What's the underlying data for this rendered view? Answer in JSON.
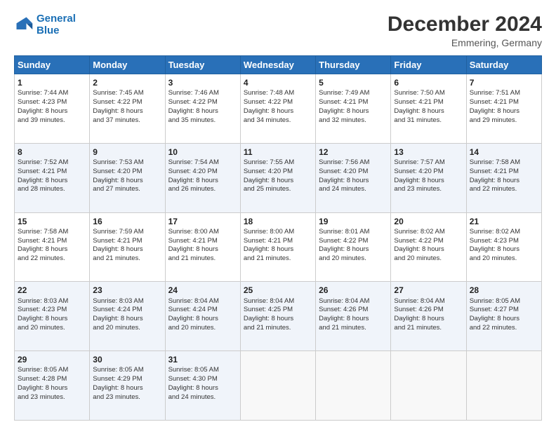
{
  "header": {
    "logo_line1": "General",
    "logo_line2": "Blue",
    "month_year": "December 2024",
    "location": "Emmering, Germany"
  },
  "days_of_week": [
    "Sunday",
    "Monday",
    "Tuesday",
    "Wednesday",
    "Thursday",
    "Friday",
    "Saturday"
  ],
  "weeks": [
    [
      {
        "day": 1,
        "lines": [
          "Sunrise: 7:44 AM",
          "Sunset: 4:23 PM",
          "Daylight: 8 hours",
          "and 39 minutes."
        ]
      },
      {
        "day": 2,
        "lines": [
          "Sunrise: 7:45 AM",
          "Sunset: 4:22 PM",
          "Daylight: 8 hours",
          "and 37 minutes."
        ]
      },
      {
        "day": 3,
        "lines": [
          "Sunrise: 7:46 AM",
          "Sunset: 4:22 PM",
          "Daylight: 8 hours",
          "and 35 minutes."
        ]
      },
      {
        "day": 4,
        "lines": [
          "Sunrise: 7:48 AM",
          "Sunset: 4:22 PM",
          "Daylight: 8 hours",
          "and 34 minutes."
        ]
      },
      {
        "day": 5,
        "lines": [
          "Sunrise: 7:49 AM",
          "Sunset: 4:21 PM",
          "Daylight: 8 hours",
          "and 32 minutes."
        ]
      },
      {
        "day": 6,
        "lines": [
          "Sunrise: 7:50 AM",
          "Sunset: 4:21 PM",
          "Daylight: 8 hours",
          "and 31 minutes."
        ]
      },
      {
        "day": 7,
        "lines": [
          "Sunrise: 7:51 AM",
          "Sunset: 4:21 PM",
          "Daylight: 8 hours",
          "and 29 minutes."
        ]
      }
    ],
    [
      {
        "day": 8,
        "lines": [
          "Sunrise: 7:52 AM",
          "Sunset: 4:21 PM",
          "Daylight: 8 hours",
          "and 28 minutes."
        ]
      },
      {
        "day": 9,
        "lines": [
          "Sunrise: 7:53 AM",
          "Sunset: 4:20 PM",
          "Daylight: 8 hours",
          "and 27 minutes."
        ]
      },
      {
        "day": 10,
        "lines": [
          "Sunrise: 7:54 AM",
          "Sunset: 4:20 PM",
          "Daylight: 8 hours",
          "and 26 minutes."
        ]
      },
      {
        "day": 11,
        "lines": [
          "Sunrise: 7:55 AM",
          "Sunset: 4:20 PM",
          "Daylight: 8 hours",
          "and 25 minutes."
        ]
      },
      {
        "day": 12,
        "lines": [
          "Sunrise: 7:56 AM",
          "Sunset: 4:20 PM",
          "Daylight: 8 hours",
          "and 24 minutes."
        ]
      },
      {
        "day": 13,
        "lines": [
          "Sunrise: 7:57 AM",
          "Sunset: 4:20 PM",
          "Daylight: 8 hours",
          "and 23 minutes."
        ]
      },
      {
        "day": 14,
        "lines": [
          "Sunrise: 7:58 AM",
          "Sunset: 4:21 PM",
          "Daylight: 8 hours",
          "and 22 minutes."
        ]
      }
    ],
    [
      {
        "day": 15,
        "lines": [
          "Sunrise: 7:58 AM",
          "Sunset: 4:21 PM",
          "Daylight: 8 hours",
          "and 22 minutes."
        ]
      },
      {
        "day": 16,
        "lines": [
          "Sunrise: 7:59 AM",
          "Sunset: 4:21 PM",
          "Daylight: 8 hours",
          "and 21 minutes."
        ]
      },
      {
        "day": 17,
        "lines": [
          "Sunrise: 8:00 AM",
          "Sunset: 4:21 PM",
          "Daylight: 8 hours",
          "and 21 minutes."
        ]
      },
      {
        "day": 18,
        "lines": [
          "Sunrise: 8:00 AM",
          "Sunset: 4:21 PM",
          "Daylight: 8 hours",
          "and 21 minutes."
        ]
      },
      {
        "day": 19,
        "lines": [
          "Sunrise: 8:01 AM",
          "Sunset: 4:22 PM",
          "Daylight: 8 hours",
          "and 20 minutes."
        ]
      },
      {
        "day": 20,
        "lines": [
          "Sunrise: 8:02 AM",
          "Sunset: 4:22 PM",
          "Daylight: 8 hours",
          "and 20 minutes."
        ]
      },
      {
        "day": 21,
        "lines": [
          "Sunrise: 8:02 AM",
          "Sunset: 4:23 PM",
          "Daylight: 8 hours",
          "and 20 minutes."
        ]
      }
    ],
    [
      {
        "day": 22,
        "lines": [
          "Sunrise: 8:03 AM",
          "Sunset: 4:23 PM",
          "Daylight: 8 hours",
          "and 20 minutes."
        ]
      },
      {
        "day": 23,
        "lines": [
          "Sunrise: 8:03 AM",
          "Sunset: 4:24 PM",
          "Daylight: 8 hours",
          "and 20 minutes."
        ]
      },
      {
        "day": 24,
        "lines": [
          "Sunrise: 8:04 AM",
          "Sunset: 4:24 PM",
          "Daylight: 8 hours",
          "and 20 minutes."
        ]
      },
      {
        "day": 25,
        "lines": [
          "Sunrise: 8:04 AM",
          "Sunset: 4:25 PM",
          "Daylight: 8 hours",
          "and 21 minutes."
        ]
      },
      {
        "day": 26,
        "lines": [
          "Sunrise: 8:04 AM",
          "Sunset: 4:26 PM",
          "Daylight: 8 hours",
          "and 21 minutes."
        ]
      },
      {
        "day": 27,
        "lines": [
          "Sunrise: 8:04 AM",
          "Sunset: 4:26 PM",
          "Daylight: 8 hours",
          "and 21 minutes."
        ]
      },
      {
        "day": 28,
        "lines": [
          "Sunrise: 8:05 AM",
          "Sunset: 4:27 PM",
          "Daylight: 8 hours",
          "and 22 minutes."
        ]
      }
    ],
    [
      {
        "day": 29,
        "lines": [
          "Sunrise: 8:05 AM",
          "Sunset: 4:28 PM",
          "Daylight: 8 hours",
          "and 23 minutes."
        ]
      },
      {
        "day": 30,
        "lines": [
          "Sunrise: 8:05 AM",
          "Sunset: 4:29 PM",
          "Daylight: 8 hours",
          "and 23 minutes."
        ]
      },
      {
        "day": 31,
        "lines": [
          "Sunrise: 8:05 AM",
          "Sunset: 4:30 PM",
          "Daylight: 8 hours",
          "and 24 minutes."
        ]
      },
      null,
      null,
      null,
      null
    ]
  ]
}
